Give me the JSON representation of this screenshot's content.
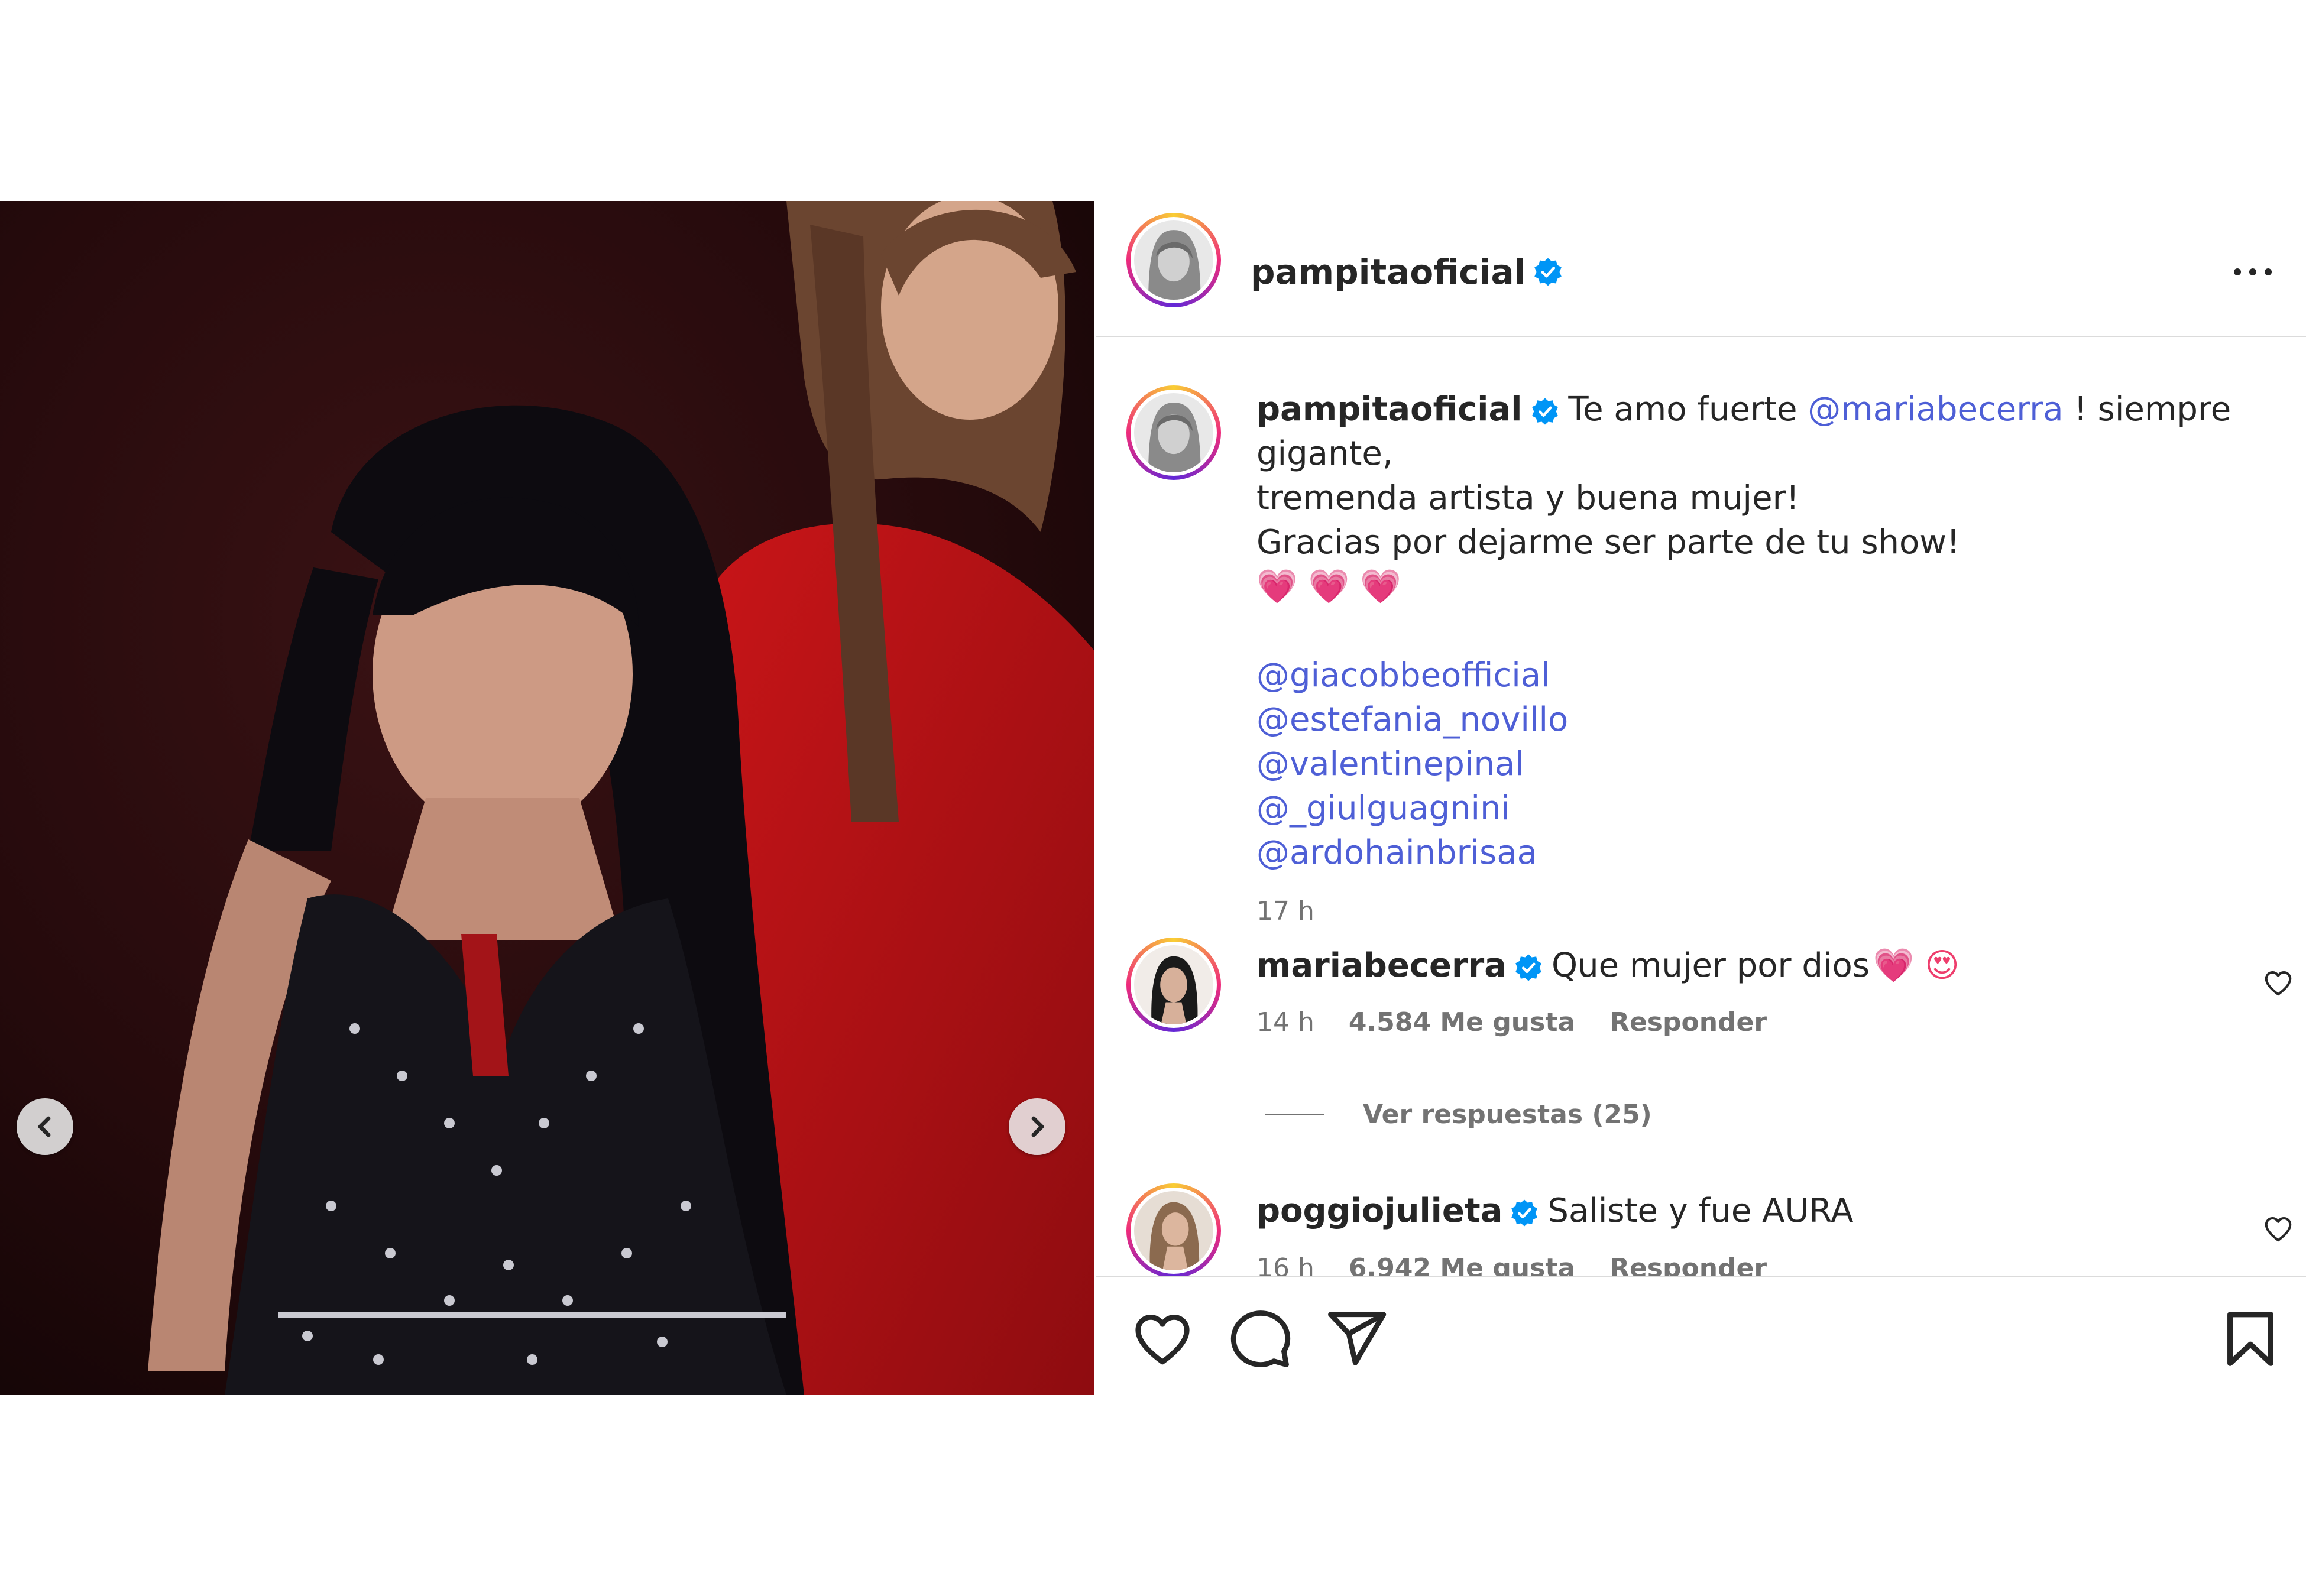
{
  "post": {
    "username": "pampitaoficial",
    "more_label": "more-options",
    "caption": {
      "username": "pampitaoficial",
      "text_before": "Te amo fuerte ",
      "mention": "@mariabecerra",
      "line1_after": " ! siempre gigante,",
      "line2": "tremenda artista y buena mujer!",
      "line3": "Gracias por dejarme ser parte de tu show!",
      "hearts": "💗 💗 💗",
      "tags": [
        "@giacobbeofficial",
        "@estefania_novillo",
        "@valentinepinal",
        "@_giulguagnini",
        "@ardohainbrisaa"
      ],
      "time": "17 h"
    },
    "comments": [
      {
        "username": "mariabecerra",
        "text": "Que mujer por dios",
        "emoji": "💗 😍",
        "time": "14 h",
        "likes": "4.584 Me gusta",
        "reply": "Responder",
        "view_replies": "Ver respuestas (25)"
      },
      {
        "username": "poggiojulieta",
        "text": "Saliste y fue AURA",
        "time": "16 h",
        "likes": "6.942 Me gusta",
        "reply": "Responder"
      }
    ]
  },
  "icons": {
    "prev": "chevron-left-icon",
    "next": "chevron-right-icon",
    "like": "heart-icon",
    "comment": "comment-icon",
    "share": "paper-plane-icon",
    "save": "bookmark-icon",
    "verified": "verified-badge-icon"
  },
  "colors": {
    "link": "#4e5fd6",
    "verified": "#0095f6",
    "secondary_text": "#737373",
    "divider": "#dbdbdb"
  }
}
